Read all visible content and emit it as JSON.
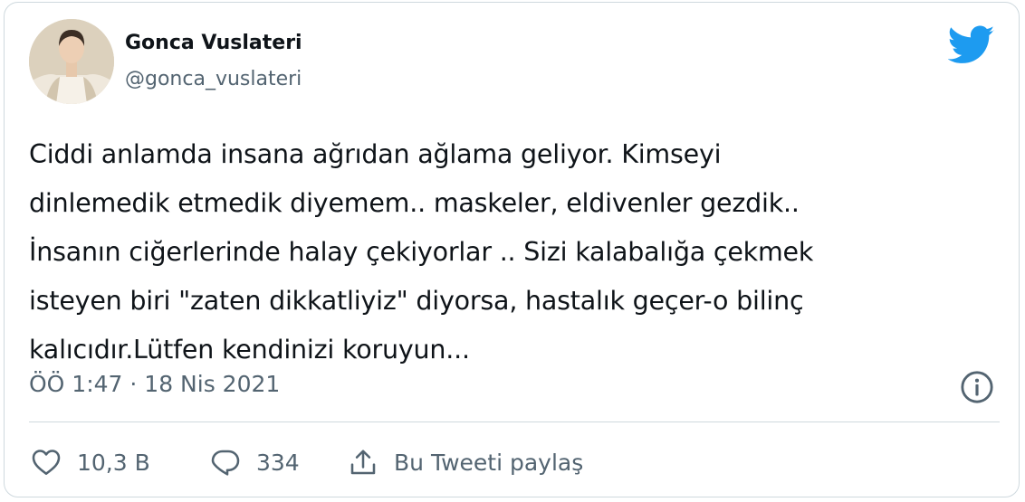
{
  "author": {
    "name": "Gonca Vuslateri",
    "handle": "@gonca_vuslateri"
  },
  "tweet": {
    "text": "Ciddi anlamda insana ağrıdan ağlama geliyor. Kimseyi\ndinlemedik etmedik diyemem.. maskeler, eldivenler gezdik..\nİnsanın ciğerlerinde halay çekiyorlar .. Sizi kalabalığa çekmek\nisteyen biri \"zaten dikkatliyiz\" diyorsa, hastalık geçer-o bilinç\nkalıcıdır.Lütfen kendinizi koruyun...",
    "timestamp": "ÖÖ 1:47 · 18 Nis 2021"
  },
  "actions": {
    "likes": "10,3 B",
    "replies": "334",
    "share_label": "Bu Tweeti paylaş"
  },
  "icons": {
    "brand": "twitter-bird-icon",
    "info": "info-icon",
    "like": "heart-icon",
    "reply": "reply-bubble-icon",
    "share": "share-icon"
  },
  "colors": {
    "brand": "#1d9bf0",
    "text": "#0f1419",
    "secondary": "#536471",
    "border": "#cfd9de"
  }
}
